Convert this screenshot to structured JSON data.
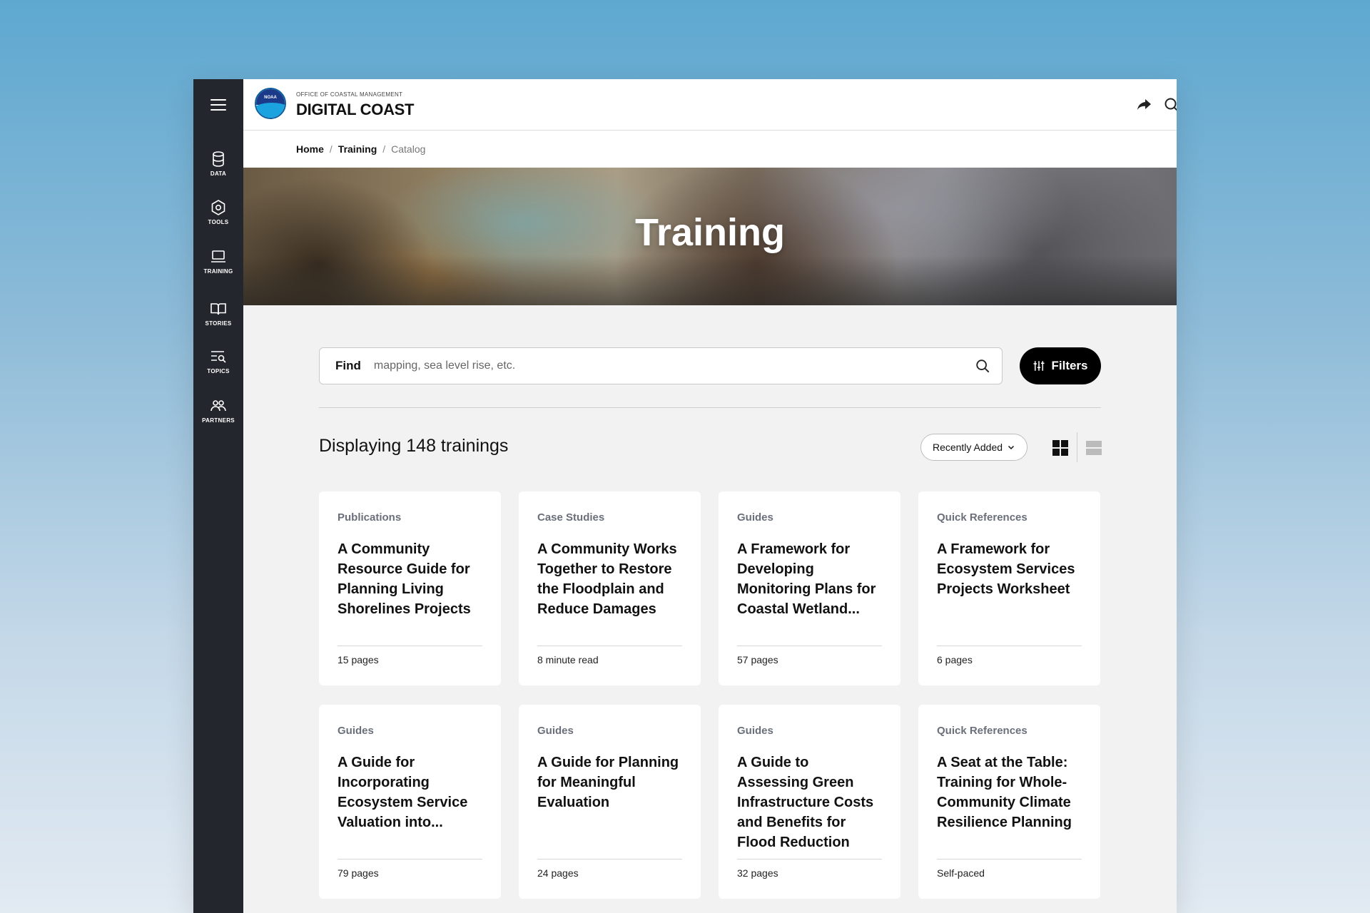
{
  "sidebar": {
    "items": [
      {
        "label": "DATA",
        "icon": "database-icon"
      },
      {
        "label": "TOOLS",
        "icon": "hexagon-tool-icon"
      },
      {
        "label": "TRAINING",
        "icon": "laptop-icon"
      },
      {
        "label": "STORIES",
        "icon": "book-icon"
      },
      {
        "label": "TOPICS",
        "icon": "topics-icon"
      },
      {
        "label": "PARTNERS",
        "icon": "people-icon"
      }
    ]
  },
  "header": {
    "logo_text": "NOAA",
    "brand_small": "OFFICE OF COASTAL MANAGEMENT",
    "brand_big": "DIGITAL COAST"
  },
  "breadcrumb": {
    "home": "Home",
    "training": "Training",
    "current": "Catalog",
    "separator": "/"
  },
  "hero": {
    "title": "Training"
  },
  "search": {
    "label": "Find",
    "placeholder": "mapping, sea level rise, etc.",
    "value": ""
  },
  "filters_label": "Filters",
  "results": {
    "count_text": "Displaying 148 trainings",
    "sort_label": "Recently Added"
  },
  "cards": [
    {
      "category": "Publications",
      "title": "A Community Resource Guide for Planning Living Shorelines Projects",
      "meta": "15 pages"
    },
    {
      "category": "Case Studies",
      "title": "A Community Works Together to Restore the Floodplain and Reduce Damages",
      "meta": "8 minute read"
    },
    {
      "category": "Guides",
      "title": "A Framework for Developing Monitoring Plans for Coastal Wetland...",
      "meta": "57 pages"
    },
    {
      "category": "Quick References",
      "title": "A Framework for Ecosystem Services Projects Worksheet",
      "meta": "6 pages"
    },
    {
      "category": "Guides",
      "title": "A Guide for Incorporating Ecosystem Service Valuation into...",
      "meta": "79 pages"
    },
    {
      "category": "Guides",
      "title": "A Guide for Planning for Meaningful Evaluation",
      "meta": "24 pages"
    },
    {
      "category": "Guides",
      "title": "A Guide to Assessing Green Infrastructure Costs and Benefits for Flood Reduction",
      "meta": "32 pages"
    },
    {
      "category": "Quick References",
      "title": "A Seat at the Table: Training for Whole-Community Climate Resilience Planning",
      "meta": "Self-paced"
    }
  ],
  "colors": {
    "sidebar_bg": "#24262d",
    "accent_button": "#000000",
    "category_text": "#6a6f7a",
    "page_bg": "#f2f2f2"
  }
}
